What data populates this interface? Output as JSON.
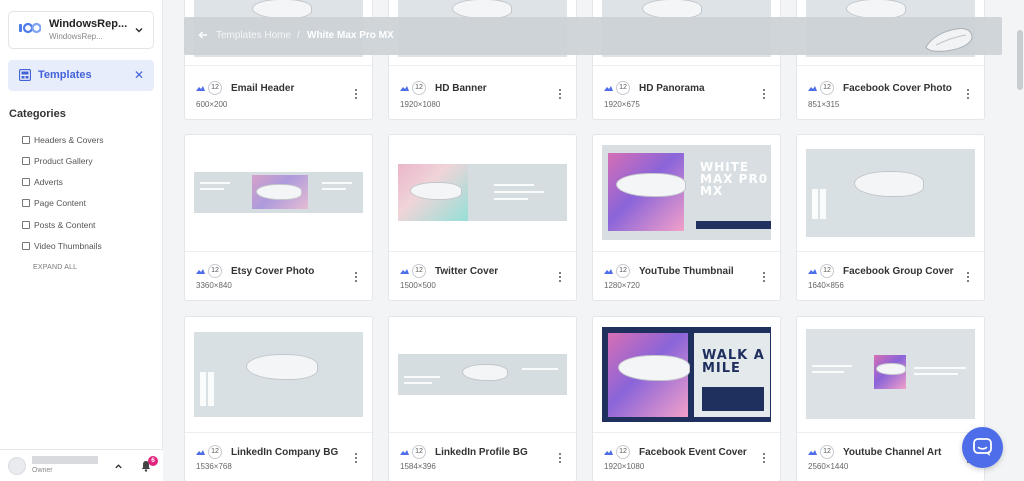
{
  "workspace": {
    "name": "WindowsRep...",
    "subtitle": "WindowsRep...",
    "logo_text": "ido"
  },
  "nav": {
    "templates_label": "Templates",
    "close_symbol": "✕"
  },
  "categories": {
    "title": "Categories",
    "items": [
      {
        "label": "Headers & Covers"
      },
      {
        "label": "Product Gallery"
      },
      {
        "label": "Adverts"
      },
      {
        "label": "Page Content"
      },
      {
        "label": "Posts & Content"
      },
      {
        "label": "Video Thumbnails"
      }
    ],
    "expand_all": "EXPAND ALL"
  },
  "user": {
    "role": "Owner",
    "notifications": "6"
  },
  "breadcrumb": {
    "home": "Templates Home",
    "separator": "/",
    "current": "White Max Pro MX"
  },
  "cards": [
    {
      "title": "Email Header",
      "dims": "600×200",
      "count": "12"
    },
    {
      "title": "HD Banner",
      "dims": "1920×1080",
      "count": "12"
    },
    {
      "title": "HD Panorama",
      "dims": "1920×675",
      "count": "12"
    },
    {
      "title": "Facebook Cover Photo",
      "dims": "851×315",
      "count": "12"
    },
    {
      "title": "Etsy Cover Photo",
      "dims": "3360×840",
      "count": "12"
    },
    {
      "title": "Twitter Cover",
      "dims": "1500×500",
      "count": "12"
    },
    {
      "title": "YouTube Thumbnail",
      "dims": "1280×720",
      "count": "12"
    },
    {
      "title": "Facebook Group Cover",
      "dims": "1640×856",
      "count": "12"
    },
    {
      "title": "LinkedIn Company BG",
      "dims": "1536×768",
      "count": "12"
    },
    {
      "title": "LinkedIn Profile BG",
      "dims": "1584×396",
      "count": "12"
    },
    {
      "title": "Facebook Event Cover",
      "dims": "1920×1080",
      "count": "12"
    },
    {
      "title": "Youtube Channel Art",
      "dims": "2560×1440",
      "count": "12"
    }
  ],
  "thumb_text": {
    "white_max": "WHITE MAX PR0 MX",
    "walk_a_mile": "WALK A MILE"
  },
  "colors": {
    "accent": "#4361d8",
    "accent_bg": "#e8edfb",
    "badge": "#e0237c",
    "chat": "#4d6ee8",
    "thumb_bg": "#dde3e6",
    "navy": "#20305f"
  },
  "icons": [
    "logo-icon",
    "chevron-down-icon",
    "templates-icon",
    "close-icon",
    "checkbox-icon",
    "bell-icon",
    "chevron-up-icon",
    "image-icon",
    "kebab-menu-icon",
    "arrow-left-icon",
    "chat-icon"
  ]
}
